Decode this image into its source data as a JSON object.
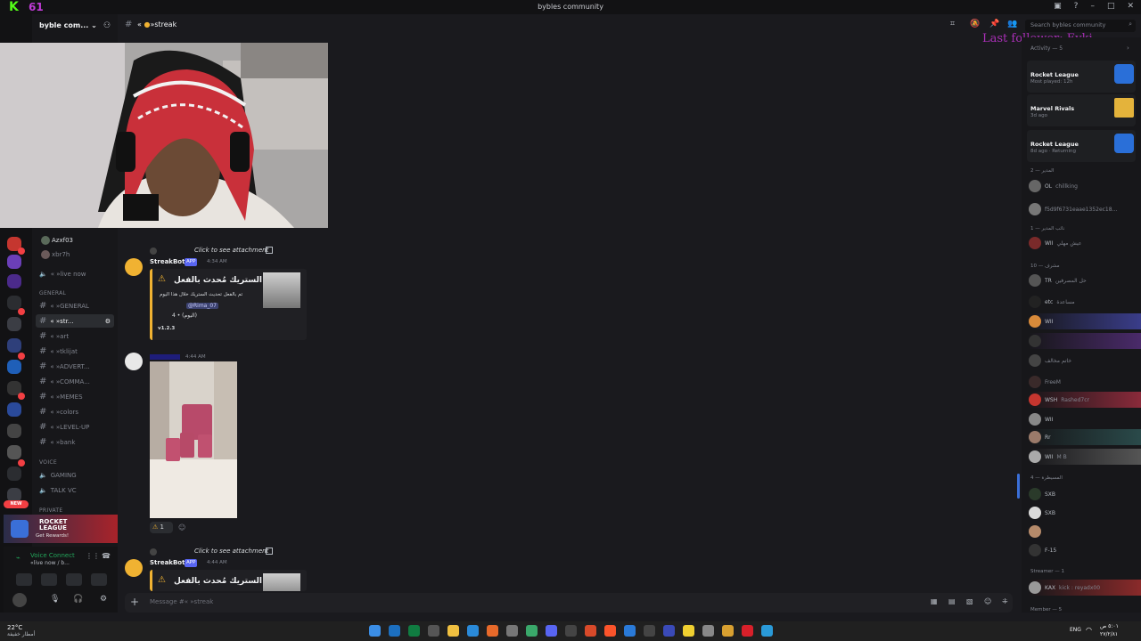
{
  "window": {
    "title": "bybles community"
  },
  "overlay": {
    "k_count": "61",
    "last_follower": "Last follower: Eyki"
  },
  "server": {
    "name": "byble com...",
    "search_placeholder": "Search bybles community"
  },
  "channel_header": {
    "name": "»streak",
    "prefix": "«"
  },
  "sidebar": {
    "top_user": "Azxf03",
    "top_user2": "xbr7h",
    "live_now": "«  »live now",
    "general_cat": "GENERAL",
    "channels": [
      {
        "label": "«  »GENERAL",
        "active": false
      },
      {
        "label": "«  »str...",
        "active": true
      },
      {
        "label": "«  »art",
        "active": false
      },
      {
        "label": "«  »tklijat",
        "active": false
      },
      {
        "label": "«  »ADVERT...",
        "active": false
      },
      {
        "label": "«  »COMMA...",
        "active": false
      },
      {
        "label": "«  »MEMES",
        "active": false
      },
      {
        "label": "«  »colors",
        "active": false
      },
      {
        "label": "«  »LEVEL-UP",
        "active": false
      },
      {
        "label": "«  »bank",
        "active": false
      }
    ],
    "voice_cat": "VOICE",
    "voice_channels": [
      "GAMING",
      "TALK VC"
    ],
    "private_cat": "PRIVATE",
    "promo": {
      "title": "ROCKET LEAGUE",
      "subtitle": "Get Rewards!"
    },
    "voice_connect": {
      "title": "Voice Connect",
      "subtitle": "«live now / b..."
    }
  },
  "messages": [
    {
      "header": "Click to see attachment",
      "author": "StreakBot",
      "app": "APP",
      "time": "4:34 AM",
      "embed": {
        "title": "الستريك مُحدث بالفعل •",
        "line1": "تم بالفعل تحديث الستريك خلال هذا اليوم",
        "mention": "@Rima_07",
        "line2": "4 • (اليوم)",
        "version": "v1.2.3"
      }
    },
    {
      "time": "4:44 AM",
      "reaction_count": "1"
    },
    {
      "header": "Click to see attachment",
      "author": "StreakBot",
      "app": "APP",
      "time": "4:44 AM",
      "embed": {
        "title": "الستريك مُحدث بالفعل •"
      }
    }
  ],
  "composer": {
    "placeholder": "Message #«  »streak"
  },
  "members": {
    "activity_title": "Activity — 5",
    "activities": [
      {
        "game": "Rocket League",
        "sub": "Most played: 12h"
      },
      {
        "game": "Marvel Rivals",
        "sub": "3d ago"
      },
      {
        "game": "Rocket League",
        "sub": "8d ago · Returning"
      }
    ],
    "groups": [
      {
        "title": "المدير — 2",
        "items": [
          {
            "tag": "OL",
            "sub": "chillking"
          },
          {
            "tag": "",
            "sub": "f5d9f6731eaae1352ec18..."
          }
        ]
      },
      {
        "title": "نائب المدير — 1",
        "items": [
          {
            "tag": "WII",
            "sub": "عيش مهلي"
          }
        ]
      },
      {
        "title": "مشرف — 10",
        "items": [
          {
            "tag": "TR",
            "sub": "حل المصرفين"
          },
          {
            "tag": "etc",
            "sub": "مساعدة"
          },
          {
            "tag": "WII",
            "sub": ""
          },
          {
            "tag": "",
            "sub": ""
          },
          {
            "tag": "",
            "sub": "خاتم مخالف"
          },
          {
            "tag": "",
            "sub": "FreeM"
          },
          {
            "tag": "WSH",
            "sub": "Rashed7cr"
          },
          {
            "tag": "WII",
            "sub": ""
          },
          {
            "tag": "Rr",
            "sub": ""
          },
          {
            "tag": "WII",
            "sub": "M B"
          }
        ]
      },
      {
        "title": "المسيطرة — 4",
        "items": [
          {
            "tag": "SXB",
            "sub": ""
          },
          {
            "tag": "SXB",
            "sub": ""
          },
          {
            "tag": "",
            "sub": ""
          },
          {
            "tag": "F-15",
            "sub": ""
          }
        ]
      },
      {
        "title": "Streamer — 1",
        "items": [
          {
            "tag": "KAX",
            "sub": "kick : reyadx00"
          }
        ]
      },
      {
        "title": "Member — 5",
        "items": []
      }
    ]
  },
  "taskbar": {
    "weather": "22°C",
    "weather_sub": "أمطار خفيفة",
    "lang": "ENG",
    "time": "٥:٠١ ص",
    "date": "٢٧/٢/٨١"
  },
  "colors": {
    "accent": "#5865f2",
    "embed_border": "#f0b232",
    "live": "#f23f43"
  }
}
